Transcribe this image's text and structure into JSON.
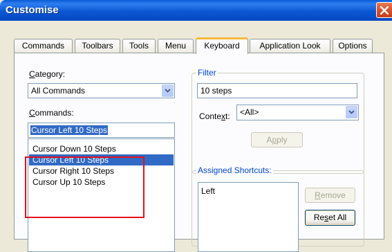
{
  "window": {
    "title": "Customise",
    "close_icon": "close-icon"
  },
  "tabs": [
    {
      "label": "Commands"
    },
    {
      "label": "Toolbars"
    },
    {
      "label": "Tools"
    },
    {
      "label": "Menu"
    },
    {
      "label": "Keyboard",
      "active": true
    },
    {
      "label": "Application Look"
    },
    {
      "label": "Options"
    }
  ],
  "category": {
    "label_first": "C",
    "label_rest": "ategory:",
    "value": "All Commands"
  },
  "commands": {
    "label_first": "C",
    "label_rest": "ommands:",
    "search_value": "Cursor Left 10 Steps",
    "items": [
      {
        "label": "Cursor Down 10 Steps"
      },
      {
        "label": "Cursor Left 10 Steps",
        "selected": true
      },
      {
        "label": "Cursor Right 10 Steps"
      },
      {
        "label": "Cursor Up 10 Steps"
      }
    ]
  },
  "filter": {
    "title": "Filter",
    "value": "10 steps",
    "context_label_pre": "Conte",
    "context_label_u": "x",
    "context_label_post": "t:",
    "context_value": "<All>",
    "apply_pre": "A",
    "apply_u": "p",
    "apply_post": "ply"
  },
  "shortcuts": {
    "title": "Assigned Shortcuts:",
    "items": [
      "Left"
    ],
    "remove_u": "R",
    "remove_rest": "emove",
    "reset_pre": "Re",
    "reset_u": "s",
    "reset_post": "et All"
  },
  "colors": {
    "accent": "#316ac5",
    "titlebar": "#0b57d3",
    "highlight_box": "#e0101c",
    "group_title": "#0046d5"
  }
}
